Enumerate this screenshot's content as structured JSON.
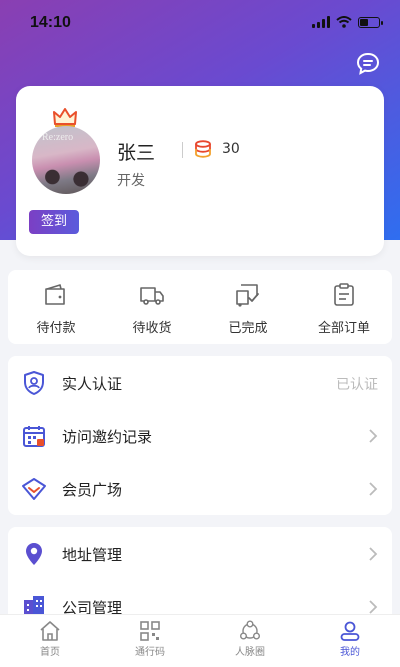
{
  "status": {
    "time": "14:10"
  },
  "profile": {
    "name": "张三",
    "role": "开发",
    "coins": "30",
    "checkin_label": "签到",
    "avatar_text": "Re:zero"
  },
  "orders": [
    {
      "label": "待付款",
      "icon": "wallet-icon"
    },
    {
      "label": "待收货",
      "icon": "truck-icon"
    },
    {
      "label": "已完成",
      "icon": "delivered-icon"
    },
    {
      "label": "全部订单",
      "icon": "clipboard-icon"
    }
  ],
  "menu_group_1": [
    {
      "label": "实人认证",
      "value": "已认证",
      "icon": "shield-user-icon"
    },
    {
      "label": "访问邀约记录",
      "icon": "calendar-icon"
    },
    {
      "label": "会员广场",
      "icon": "diamond-icon"
    }
  ],
  "menu_group_2": [
    {
      "label": "地址管理",
      "icon": "location-pin-icon"
    },
    {
      "label": "公司管理",
      "icon": "building-icon"
    }
  ],
  "tabs": [
    {
      "label": "首页",
      "icon": "home-icon"
    },
    {
      "label": "通行码",
      "icon": "qr-code-icon"
    },
    {
      "label": "人脉圈",
      "icon": "network-icon"
    },
    {
      "label": "我的",
      "icon": "user-icon",
      "active": true
    }
  ],
  "colors": {
    "accent": "#4a56d6",
    "gradient_start": "#8a3fb2",
    "gradient_end": "#2f6ef0"
  }
}
